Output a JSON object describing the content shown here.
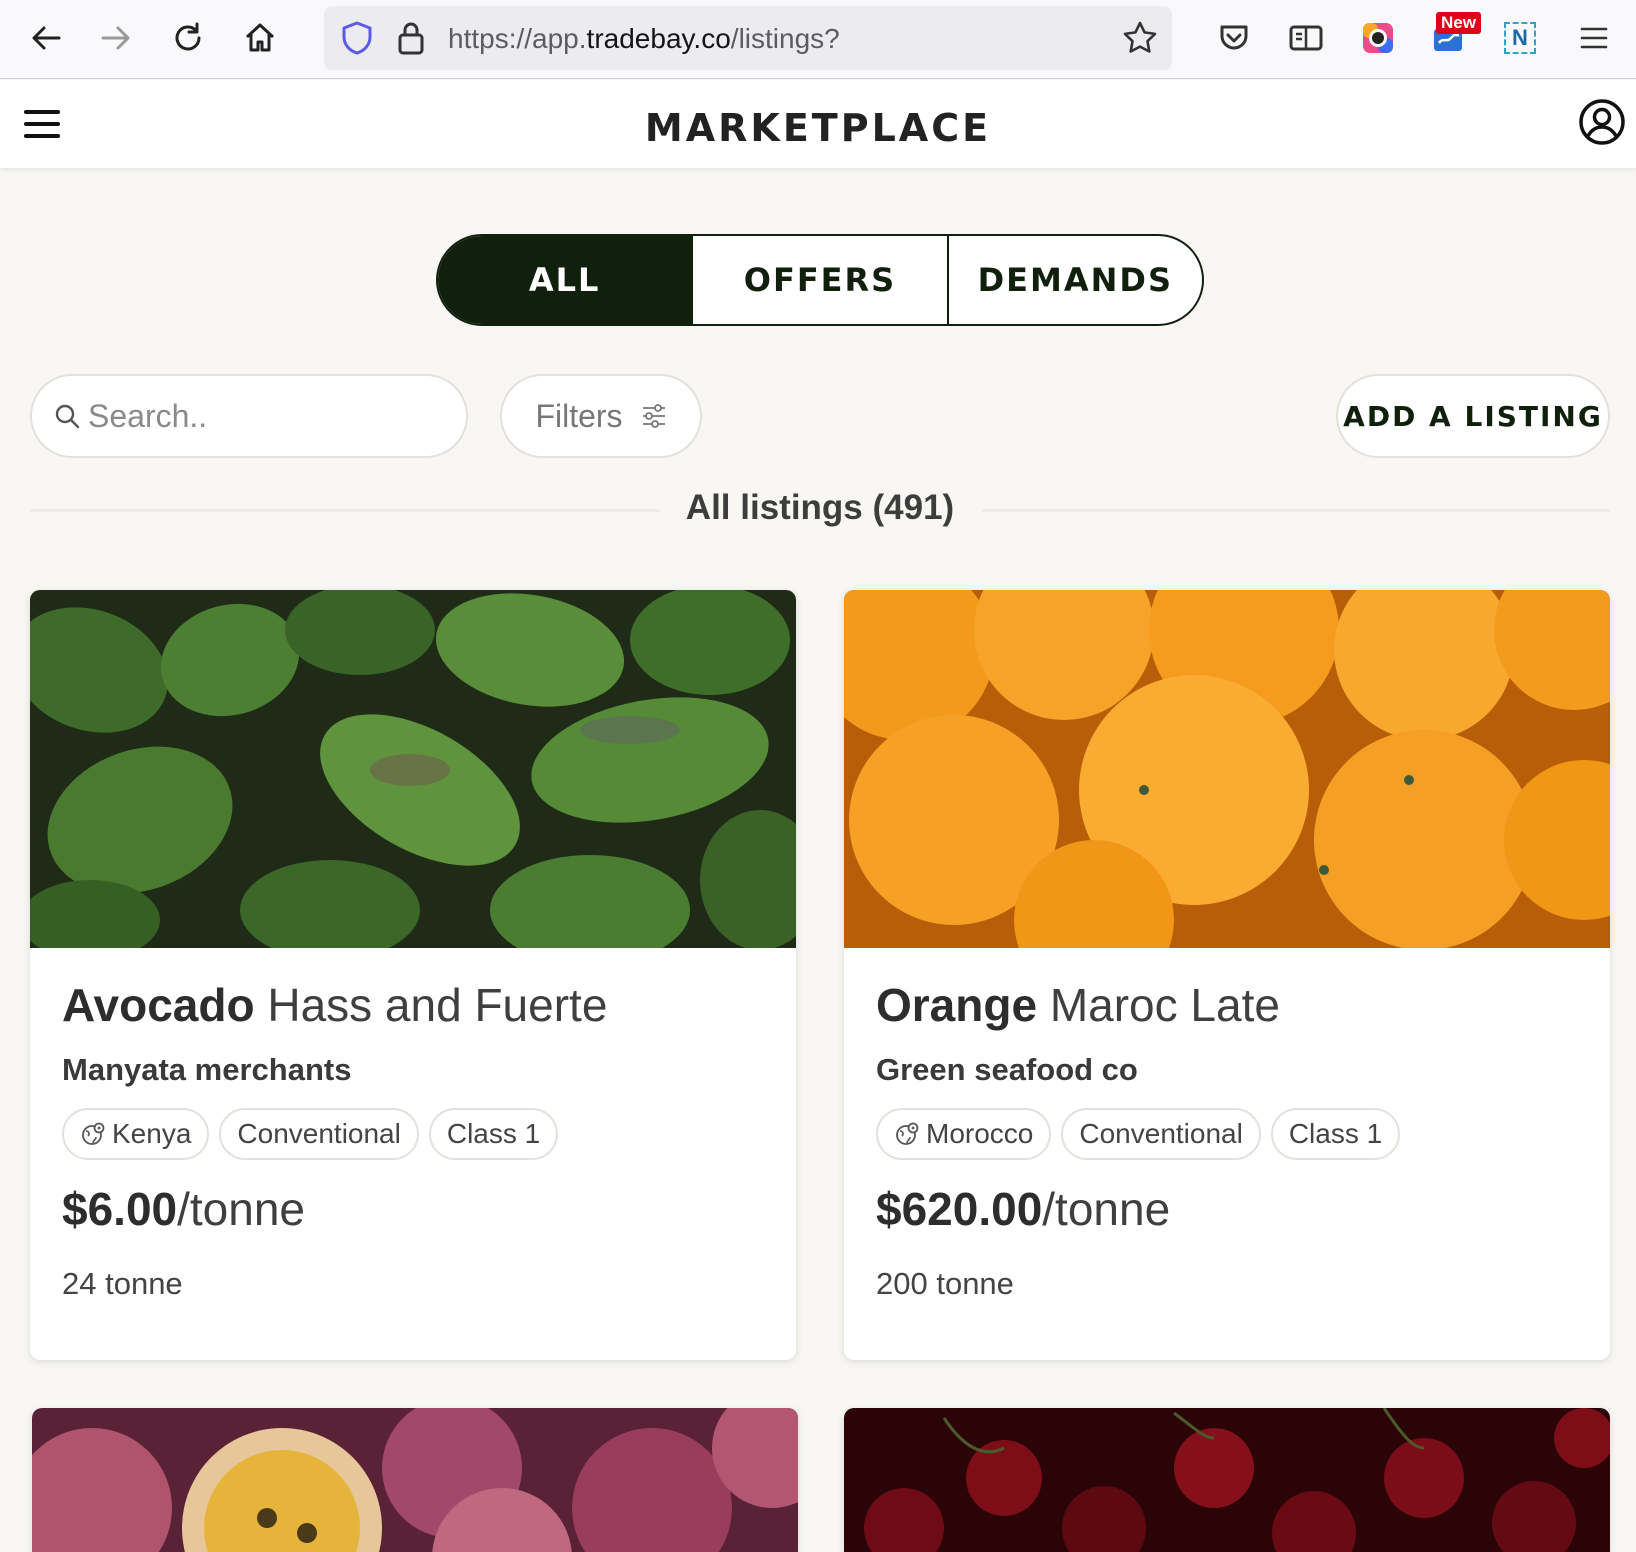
{
  "browser": {
    "url_prefix": "https://app.",
    "url_domain": "tradebay.co",
    "url_path": "/listings?",
    "new_badge": "New",
    "extension_letter": "N"
  },
  "header": {
    "title": "MARKETPLACE"
  },
  "tabs": [
    {
      "label": "ALL",
      "active": true
    },
    {
      "label": "OFFERS",
      "active": false
    },
    {
      "label": "DEMANDS",
      "active": false
    }
  ],
  "toolbar": {
    "search_placeholder": "Search..",
    "filters_label": "Filters",
    "add_listing_label": "ADD A LISTING"
  },
  "listing_count": "All listings (491)",
  "listings": [
    {
      "product": "Avocado",
      "variety": "Hass and Fuerte",
      "seller": "Manyata merchants",
      "origin": "Kenya",
      "method": "Conventional",
      "grade": "Class 1",
      "price": "$6.00",
      "unit": "/tonne",
      "quantity": "24 tonne"
    },
    {
      "product": "Orange",
      "variety": "Maroc Late",
      "seller": "Green seafood co",
      "origin": "Morocco",
      "method": "Conventional",
      "grade": "Class 1",
      "price": "$620.00",
      "unit": "/tonne",
      "quantity": "200 tonne"
    }
  ],
  "colors": {
    "accent": "#11200c",
    "background": "#f8f7f3"
  }
}
